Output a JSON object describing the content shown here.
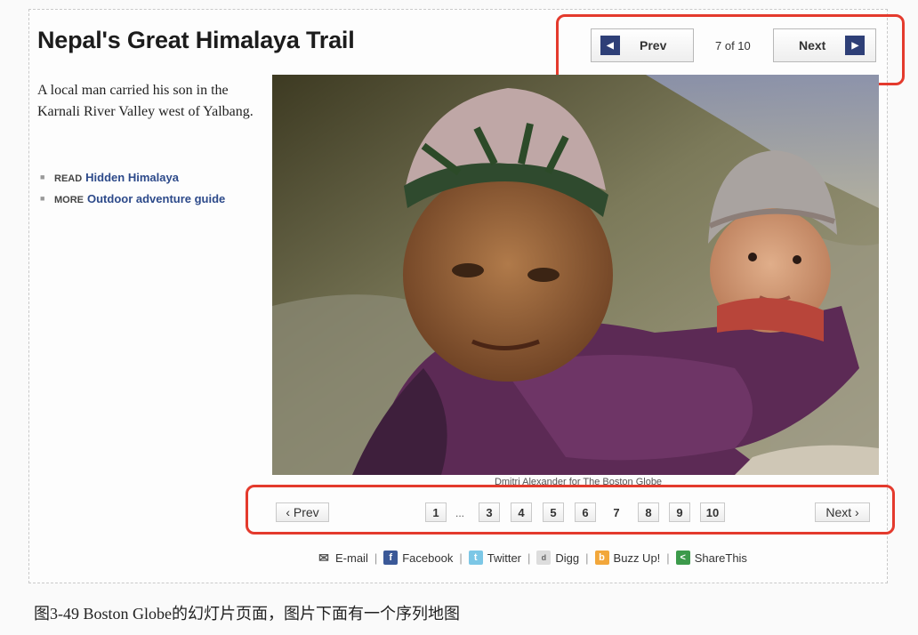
{
  "slideshow": {
    "title": "Nepal's Great Himalaya Trail",
    "caption": "A local man carried his son in the Karnali River Valley west of Yalbang.",
    "links": [
      {
        "kind": "READ",
        "label": "Hidden Himalaya"
      },
      {
        "kind": "MORE",
        "label": "Outdoor adventure guide"
      }
    ],
    "top_pager": {
      "prev": "Prev",
      "next": "Next",
      "counter": "7 of 10",
      "prev_arrow": "◀",
      "next_arrow": "▶"
    },
    "photo_credit": "Dmitri Alexander for The Boston Globe",
    "bottom_pager": {
      "prev": "‹ Prev",
      "next": "Next ›",
      "first": "1",
      "ellipsis": "...",
      "pages": [
        "3",
        "4",
        "5",
        "6",
        "7",
        "8",
        "9",
        "10"
      ],
      "current": "7"
    },
    "share": [
      {
        "label": "E-mail",
        "icon": "mail-icon"
      },
      {
        "label": "Facebook",
        "icon": "facebook-icon"
      },
      {
        "label": "Twitter",
        "icon": "twitter-icon"
      },
      {
        "label": "Digg",
        "icon": "digg-icon"
      },
      {
        "label": "Buzz Up!",
        "icon": "buzzup-icon"
      },
      {
        "label": "ShareThis",
        "icon": "sharethis-icon"
      }
    ],
    "share_separator": "|"
  },
  "figure_caption": "图3-49  Boston Globe的幻灯片页面，图片下面有一个序列地图",
  "colors": {
    "highlight": "#e43a2d",
    "nav_square": "#2e3f77",
    "link": "#2d4a8a"
  }
}
